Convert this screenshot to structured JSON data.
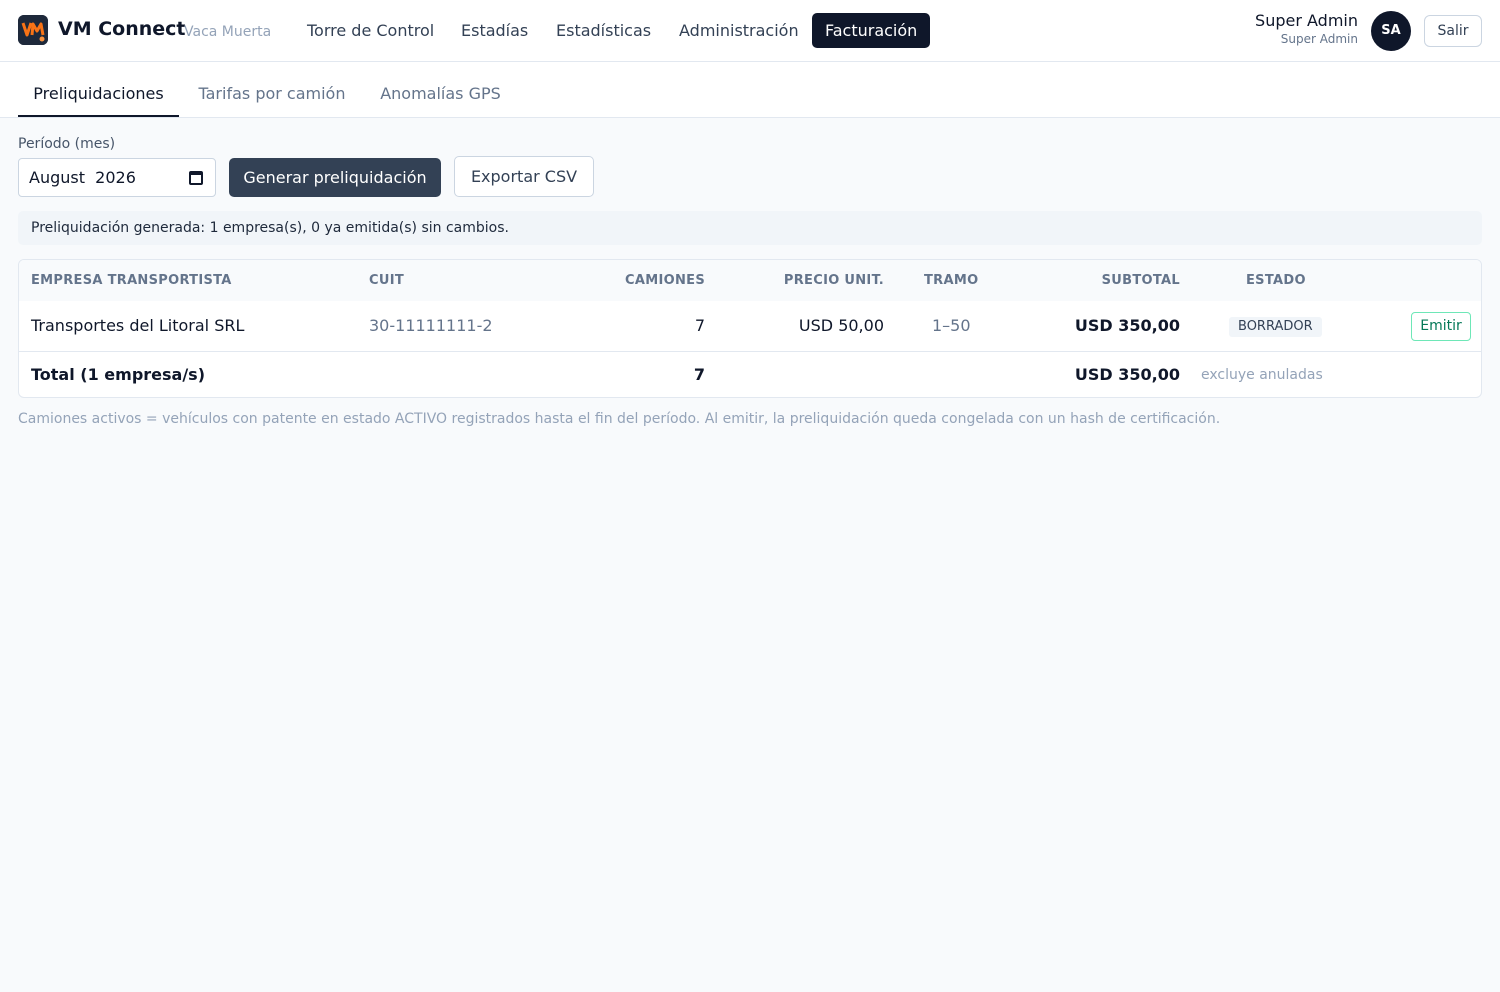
{
  "app": {
    "brand": "VM Connect",
    "brand_sub": "Vaca Muerta",
    "logo_icon": "vm-logo-icon",
    "accent": "#0f172a"
  },
  "nav": {
    "items": [
      {
        "label": "Torre de Control",
        "active": false
      },
      {
        "label": "Estadías",
        "active": false
      },
      {
        "label": "Estadísticas",
        "active": false
      },
      {
        "label": "Administración",
        "active": false
      },
      {
        "label": "Facturación",
        "active": true
      }
    ]
  },
  "user": {
    "name": "Super Admin",
    "role": "Super Admin",
    "initials": "SA",
    "logout_label": "Salir"
  },
  "tabs": [
    {
      "label": "Preliquidaciones",
      "active": true
    },
    {
      "label": "Tarifas por camión",
      "active": false
    },
    {
      "label": "Anomalías GPS",
      "active": false
    }
  ],
  "controls": {
    "period_label": "Período (mes)",
    "period_value": "August  2026",
    "generate_label": "Generar preliquidación",
    "export_label": "Exportar CSV"
  },
  "notice": "Preliquidación generada: 1 empresa(s), 0 ya emitida(s) sin cambios.",
  "table": {
    "headers": {
      "empresa": "EMPRESA TRANSPORTISTA",
      "cuit": "CUIT",
      "camiones": "CAMIONES",
      "precio": "PRECIO UNIT.",
      "tramo": "TRAMO",
      "subtotal": "SUBTOTAL",
      "estado": "ESTADO"
    },
    "rows": [
      {
        "empresa": "Transportes del Litoral SRL",
        "cuit": "30-11111111-2",
        "camiones": "7",
        "precio": "USD 50,00",
        "tramo": "1–50",
        "subtotal": "USD 350,00",
        "estado": "BORRADOR",
        "action_label": "Emitir"
      }
    ],
    "total": {
      "label": "Total (1 empresa/s)",
      "camiones": "7",
      "subtotal": "USD 350,00",
      "note": "excluye anuladas"
    }
  },
  "footnote": "Camiones activos = vehículos con patente en estado ACTIVO registrados hasta el fin del período. Al emitir, la preliquidación queda congelada con un hash de certificación."
}
